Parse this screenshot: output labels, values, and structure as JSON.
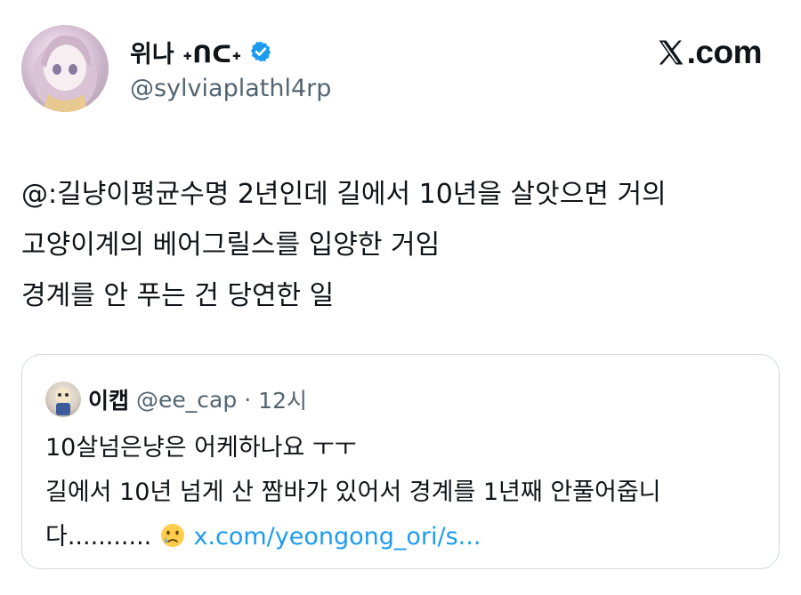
{
  "author": {
    "display_name": "위나 ˖ᑎᑕ˖",
    "handle": "@sylviaplathl4rp",
    "verified": true
  },
  "site": {
    "logo_text": ".com",
    "logo_icon": "x-logo-icon"
  },
  "tweet": {
    "lines": [
      "@:길냥이평균수명 2년인데 길에서 10년을 살앗으면 거의",
      "고양이계의 베어그릴스를 입양한 거임",
      "경계를 안 푸는 건 당연한 일"
    ]
  },
  "quote": {
    "display_name": "이캡",
    "handle": "@ee_cap",
    "separator": "·",
    "time": "12시",
    "lines": [
      "10살넘은냥은 어케하나요 ㅜㅜ",
      "길에서 10년 넘게 산 짬바가 있어서 경계를 1년째 안풀어줍니",
      "다..........."
    ],
    "link": "x.com/yeongong_ori/s...",
    "emoji": "crying-face-icon"
  },
  "colors": {
    "text": "#0f1419",
    "secondary": "#536471",
    "link": "#1d9bf0",
    "verified": "#1d9bf0",
    "border": "#cfd9de"
  }
}
